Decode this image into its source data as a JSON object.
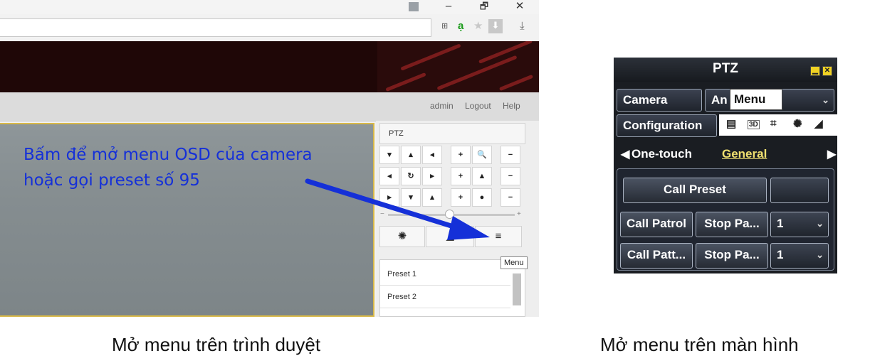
{
  "browser": {
    "window_controls": {
      "minimize": "–",
      "maximize": "🗗",
      "close": "✕"
    },
    "extensions": {
      "vietnamese_ime": "ạ"
    },
    "nav": {
      "admin": "admin",
      "logout": "Logout",
      "help": "Help"
    },
    "annotation": {
      "line1": "Bấm để mở menu OSD của camera",
      "line2": "hoặc gọi preset số 95",
      "color": "#1530d8"
    },
    "ptz": {
      "header": "PTZ",
      "tooltip": "Menu",
      "presets": [
        "Preset 1",
        "Preset 2"
      ]
    }
  },
  "osd": {
    "title": "PTZ",
    "camera_label": "Camera",
    "camera_value": "An",
    "menu_tooltip": "Menu",
    "configuration_label": "Configuration",
    "icons": [
      "menu-icon",
      "3d-icon",
      "zoom-area-icon",
      "light-icon",
      "wiper-icon"
    ],
    "tabs": {
      "one_touch": "One-touch",
      "general": "General"
    },
    "call_preset": "Call Preset",
    "call_patrol": "Call Patrol",
    "stop_patrol": "Stop Pa...",
    "patrol_value": "1",
    "call_pattern": "Call Patt...",
    "stop_pattern": "Stop Pa...",
    "pattern_value": "1",
    "accent_color": "#f0d224"
  },
  "captions": {
    "left": "Mở menu trên trình duyệt",
    "right": "Mở menu trên màn hình"
  }
}
